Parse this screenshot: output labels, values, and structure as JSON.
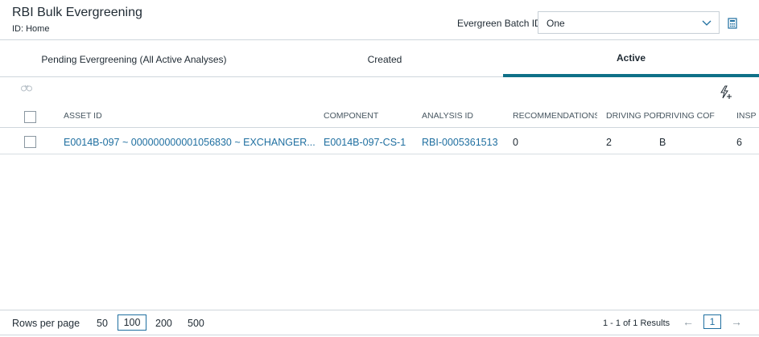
{
  "header": {
    "title": "RBI Bulk Evergreening",
    "subtitle": "ID: Home",
    "batch_label": "Evergreen Batch ID:",
    "batch_value": "One"
  },
  "tabs": [
    {
      "label": "Pending Evergreening (All Active Analyses)"
    },
    {
      "label": "Created"
    },
    {
      "label": "Active",
      "active": true
    }
  ],
  "grid": {
    "columns": [
      "ASSET ID",
      "COMPONENT",
      "ANALYSIS ID",
      "RECOMMENDATIONS",
      "DRIVING POF",
      "DRIVING COF",
      "INSP"
    ],
    "rows": [
      {
        "asset_id": "E0014B-097 ~ 000000000001056830 ~ EXCHANGER...",
        "component": "E0014B-097-CS-1",
        "analysis_id": "RBI-0005361513",
        "recommendations": "0",
        "driving_pof": "2",
        "driving_cof": "B",
        "insp": "6"
      }
    ]
  },
  "footer": {
    "rows_per_page_label": "Rows per page",
    "options": [
      "50",
      "100",
      "200",
      "500"
    ],
    "selected_option": "100",
    "results": "1 - 1 of 1 Results",
    "prev": "←",
    "next": "→",
    "page": "1"
  },
  "colors": {
    "accent": "#0f7088",
    "link": "#1f6fa0",
    "border": "#cfd6dc"
  },
  "icons": [
    "chevron-down-icon",
    "calculator-icon",
    "binoculars-icon",
    "bolt-plus-icon"
  ]
}
